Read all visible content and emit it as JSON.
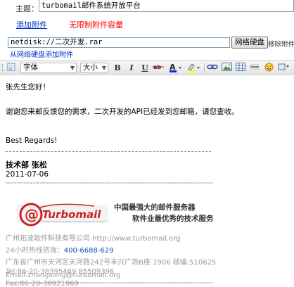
{
  "subject": {
    "label": "主题：",
    "value": "turbomail邮件系统开放平台"
  },
  "attachments": {
    "add_label": "添加附件",
    "unlimited_label": "无限制附件容量"
  },
  "netdisk": {
    "value": "netdisk://二次开发.rar",
    "button_label": "网络硬盘",
    "remove_label": "移除附件",
    "add_from_netdisk": "从网络硬盘添加附件"
  },
  "toolbar": {
    "font_select": "字体",
    "size_select": "大小",
    "bold": "B",
    "italic": "I",
    "underline": "U",
    "strike": "ab€"
  },
  "body": {
    "greeting": "张先生您好！",
    "message": "谢谢您来邮反馈您的需求，二次开发的API已经发到您邮箱，请您查收。",
    "closing": "Best Regards!",
    "signature": "技术部 张松",
    "date": "2011-07-06",
    "star_line": "****************************************************************************************************************************************************************************************",
    "logo_text": "Turbomail",
    "slogan1": "中国最强大的邮件服务器",
    "slogan2": "软件业最优秀的技术服务",
    "company": "广州拓波软件科技有限公司 http://www.turbomail.org",
    "hotline_label": "24小时热线咨询：",
    "hotline_number": "400-6688-629",
    "address": "广东省广州市天河区天河路242号丰兴广场B座 1906 邮编:510625",
    "tel": "Tel:86-20-38395469 85509396",
    "fax": "Fax:86-20-38921969",
    "email": "Email:zhangsong@turbomail.org"
  },
  "colors": {
    "link": "#0033cc",
    "warning": "#ff0000",
    "hotline": "#1b4fb3",
    "logo_red": "#cc2222"
  }
}
